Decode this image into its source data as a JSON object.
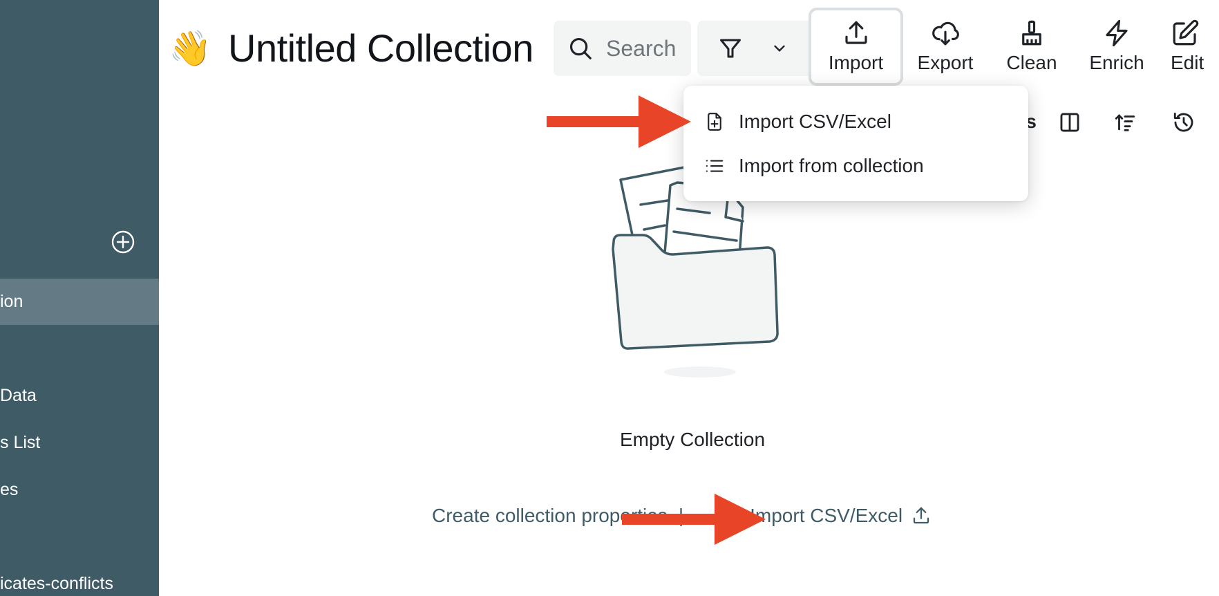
{
  "sidebar": {
    "items": [
      {
        "label": "ion",
        "active": true
      },
      {
        "label": " Data",
        "active": false
      },
      {
        "label": "s List",
        "active": false
      },
      {
        "label": "es",
        "active": false
      },
      {
        "label": "icates-conflicts",
        "active": false
      }
    ],
    "add_icon": "plus-circle-icon",
    "colors": {
      "background": "#3f5b66",
      "active": "#647b85"
    }
  },
  "header": {
    "emoji": "👋",
    "title": "Untitled Collection",
    "search": {
      "placeholder": "Search",
      "value": ""
    },
    "filter_icon": "filter-icon",
    "toolbar": [
      {
        "label": "Import",
        "icon": "upload-icon",
        "active": true
      },
      {
        "label": "Export",
        "icon": "cloud-download-icon"
      },
      {
        "label": "Clean",
        "icon": "broom-icon"
      },
      {
        "label": "Enrich",
        "icon": "lightning-icon"
      },
      {
        "label": "Edit",
        "icon": "edit-icon"
      }
    ]
  },
  "row2": {
    "label_fragment": "s",
    "icons": [
      "columns-icon",
      "sort-icon",
      "history-icon"
    ]
  },
  "import_menu": {
    "items": [
      {
        "label": "Import CSV/Excel",
        "icon": "file-plus-icon"
      },
      {
        "label": "Import from collection",
        "icon": "list-icon"
      }
    ]
  },
  "empty_state": {
    "title": "Empty Collection",
    "create_link": "Create collection properties",
    "separator": "|",
    "import_link": "Import CSV/Excel"
  },
  "annotations": {
    "arrow_color": "#e84427"
  }
}
